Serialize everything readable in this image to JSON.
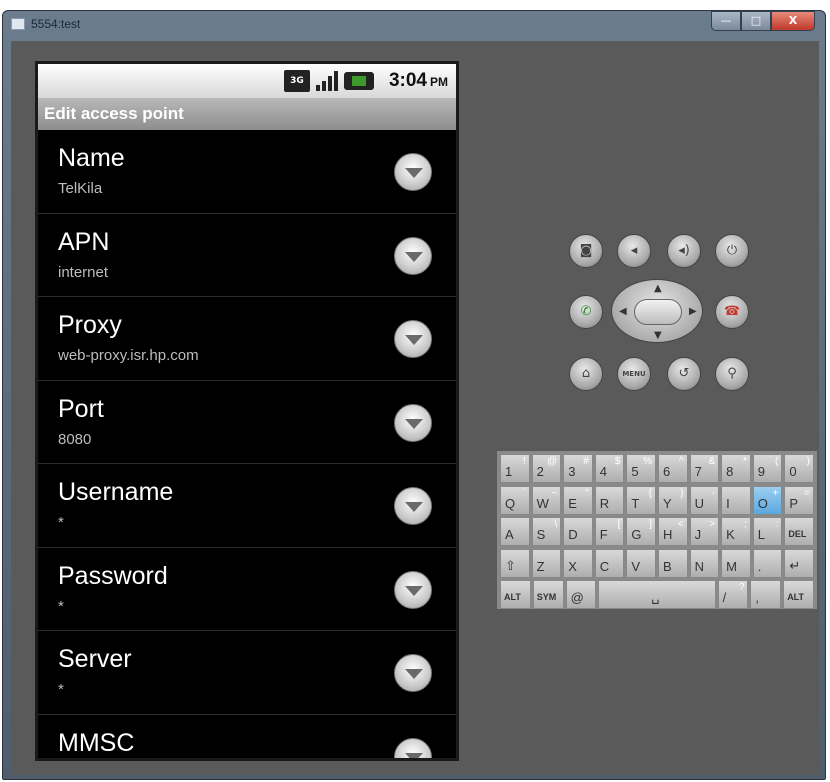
{
  "window": {
    "title": "5554:test",
    "buttons": {
      "minimize": "—",
      "maximize": "□",
      "close": "X"
    }
  },
  "status_bar": {
    "network": "3G",
    "time": "3:04",
    "ampm": "PM"
  },
  "header": {
    "title": "Edit access point"
  },
  "preferences": [
    {
      "title": "Name",
      "value": "TelKila"
    },
    {
      "title": "APN",
      "value": "internet"
    },
    {
      "title": "Proxy",
      "value": "web-proxy.isr.hp.com"
    },
    {
      "title": "Port",
      "value": "8080"
    },
    {
      "title": "Username",
      "value": "*"
    },
    {
      "title": "Password",
      "value": "*"
    },
    {
      "title": "Server",
      "value": "*"
    },
    {
      "title": "MMSC",
      "value": ""
    }
  ],
  "controls": {
    "menu_label": "MENU"
  },
  "keyboard": {
    "row1": [
      {
        "main": "1",
        "alt": "!"
      },
      {
        "main": "2",
        "alt": "@"
      },
      {
        "main": "3",
        "alt": "#"
      },
      {
        "main": "4",
        "alt": "$"
      },
      {
        "main": "5",
        "alt": "%"
      },
      {
        "main": "6",
        "alt": "^"
      },
      {
        "main": "7",
        "alt": "&"
      },
      {
        "main": "8",
        "alt": "*"
      },
      {
        "main": "9",
        "alt": "("
      },
      {
        "main": "0",
        "alt": ")"
      }
    ],
    "row2": [
      {
        "main": "Q",
        "alt": "`"
      },
      {
        "main": "W",
        "alt": "~"
      },
      {
        "main": "E",
        "alt": "\""
      },
      {
        "main": "R",
        "alt": ""
      },
      {
        "main": "T",
        "alt": "{"
      },
      {
        "main": "Y",
        "alt": "}"
      },
      {
        "main": "U",
        "alt": "-"
      },
      {
        "main": "I",
        "alt": ""
      },
      {
        "main": "O",
        "alt": "+"
      },
      {
        "main": "P",
        "alt": "="
      }
    ],
    "row3": [
      {
        "main": "A",
        "alt": ""
      },
      {
        "main": "S",
        "alt": "\\"
      },
      {
        "main": "D",
        "alt": ""
      },
      {
        "main": "F",
        "alt": "["
      },
      {
        "main": "G",
        "alt": "]"
      },
      {
        "main": "H",
        "alt": "<"
      },
      {
        "main": "J",
        "alt": ">"
      },
      {
        "main": "K",
        "alt": ";"
      },
      {
        "main": "L",
        "alt": ":"
      },
      {
        "main": "DEL",
        "alt": ""
      }
    ],
    "row4": [
      {
        "main": "⇧",
        "alt": ""
      },
      {
        "main": "Z",
        "alt": ""
      },
      {
        "main": "X",
        "alt": ""
      },
      {
        "main": "C",
        "alt": ""
      },
      {
        "main": "V",
        "alt": ""
      },
      {
        "main": "B",
        "alt": ""
      },
      {
        "main": "N",
        "alt": ""
      },
      {
        "main": "M",
        "alt": ""
      },
      {
        "main": ".",
        "alt": ""
      },
      {
        "main": "↵",
        "alt": ""
      }
    ],
    "row5": {
      "alt_left": "ALT",
      "sym": "SYM",
      "at": "@",
      "space": "␣",
      "slash": "/",
      "question": "?",
      "comma": ",",
      "alt_right": "ALT"
    }
  }
}
